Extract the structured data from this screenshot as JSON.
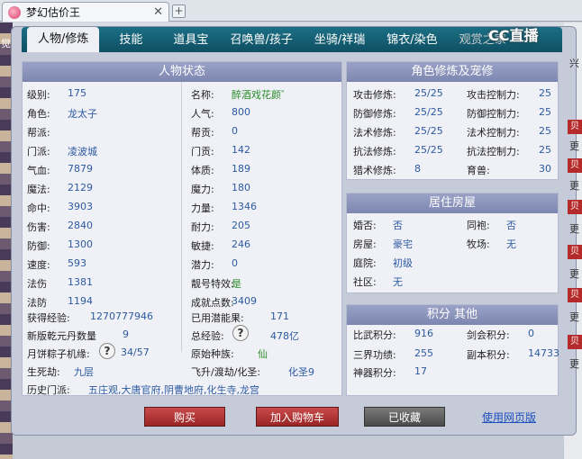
{
  "browser": {
    "tab_title": "梦幻估价王",
    "close": "✕",
    "new_tab": "+"
  },
  "nav": {
    "tabs": [
      "人物/修炼",
      "技能",
      "道具",
      "召唤兽/孩子",
      "坐骑/祥瑞",
      "锦衣/染色",
      "观赏之家"
    ],
    "partial_tab": "宝",
    "logo": "CC直播"
  },
  "status": {
    "title": "人物状态",
    "left": [
      [
        "级别:",
        "175"
      ],
      [
        "角色:",
        "龙太子"
      ],
      [
        "帮派:",
        ""
      ],
      [
        "门派:",
        "凌波城"
      ],
      [
        "气血:",
        "7879"
      ],
      [
        "魔法:",
        "2129"
      ],
      [
        "命中:",
        "3903"
      ],
      [
        "伤害:",
        "2840"
      ],
      [
        "防御:",
        "1300"
      ],
      [
        "速度:",
        "593"
      ],
      [
        "法伤",
        "1381"
      ],
      [
        "法防",
        "1194"
      ]
    ],
    "right": [
      [
        "名称:",
        "醉酒戏花颜゛"
      ],
      [
        "人气:",
        "800"
      ],
      [
        "帮贡:",
        "0"
      ],
      [
        "门贡:",
        "142"
      ],
      [
        "体质:",
        "189"
      ],
      [
        "魔力:",
        "180"
      ],
      [
        "力量:",
        "1346"
      ],
      [
        "耐力:",
        "205"
      ],
      [
        "敏捷:",
        "246"
      ],
      [
        "潜力:",
        "0"
      ],
      [
        "靓号特效:",
        "是"
      ],
      [
        "成就点数:",
        "3409"
      ]
    ],
    "exp_label": "获得经验:",
    "exp": "1270777946",
    "used_pot_label": "已用潜能果:",
    "used_pot": "171",
    "dan_label": "新版乾元丹数量",
    "dan": "9",
    "total_exp_label": "总经验:",
    "total_exp": "478亿",
    "zongzi_label": "月饼粽子机缘:",
    "zongzi": "34/57",
    "race_label": "原始种族:",
    "race": "仙",
    "life_label": "生死劫:",
    "life": "九层",
    "fly_label": "飞升/渡劫/化圣:",
    "fly": "化圣9",
    "history_label": "历史门派:",
    "history": "五庄观,大唐官府,阴曹地府,化生寺,龙宫",
    "help": "?"
  },
  "cultivation": {
    "title": "角色修炼及宠修",
    "left": [
      [
        "攻击修炼:",
        "25/25"
      ],
      [
        "防御修炼:",
        "25/25"
      ],
      [
        "法术修炼:",
        "25/25"
      ],
      [
        "抗法修炼:",
        "25/25"
      ],
      [
        "猎术修炼:",
        "8"
      ]
    ],
    "right": [
      [
        "攻击控制力:",
        "25"
      ],
      [
        "防御控制力:",
        "25"
      ],
      [
        "法术控制力:",
        "25"
      ],
      [
        "抗法控制力:",
        "25"
      ],
      [
        "育兽:",
        "30"
      ]
    ]
  },
  "house": {
    "title": "居住房屋",
    "left": [
      [
        "婚否:",
        "否"
      ],
      [
        "房屋:",
        "豪宅"
      ],
      [
        "庭院:",
        "初级"
      ],
      [
        "社区:",
        "无"
      ]
    ],
    "right": [
      [
        "同袍:",
        "否"
      ],
      [
        "牧场:",
        "无"
      ]
    ]
  },
  "points": {
    "title": "积分 其他",
    "left": [
      [
        "比武积分:",
        "916"
      ],
      [
        "三界功绩:",
        "255"
      ],
      [
        "神器积分:",
        "17"
      ]
    ],
    "right": [
      [
        "剑会积分:",
        "0"
      ],
      [
        "副本积分:",
        "14733"
      ]
    ]
  },
  "actions": {
    "buy": "购买",
    "add_cart": "加入购物车",
    "collected": "已收藏",
    "web": "使用网页版"
  },
  "side": {
    "left_edge": "觉",
    "right_labels": [
      "兴",
      "贝",
      "更",
      "贝",
      "更",
      "贝",
      "更",
      "贝",
      "更",
      "贝",
      "更",
      "贝",
      "更"
    ]
  }
}
